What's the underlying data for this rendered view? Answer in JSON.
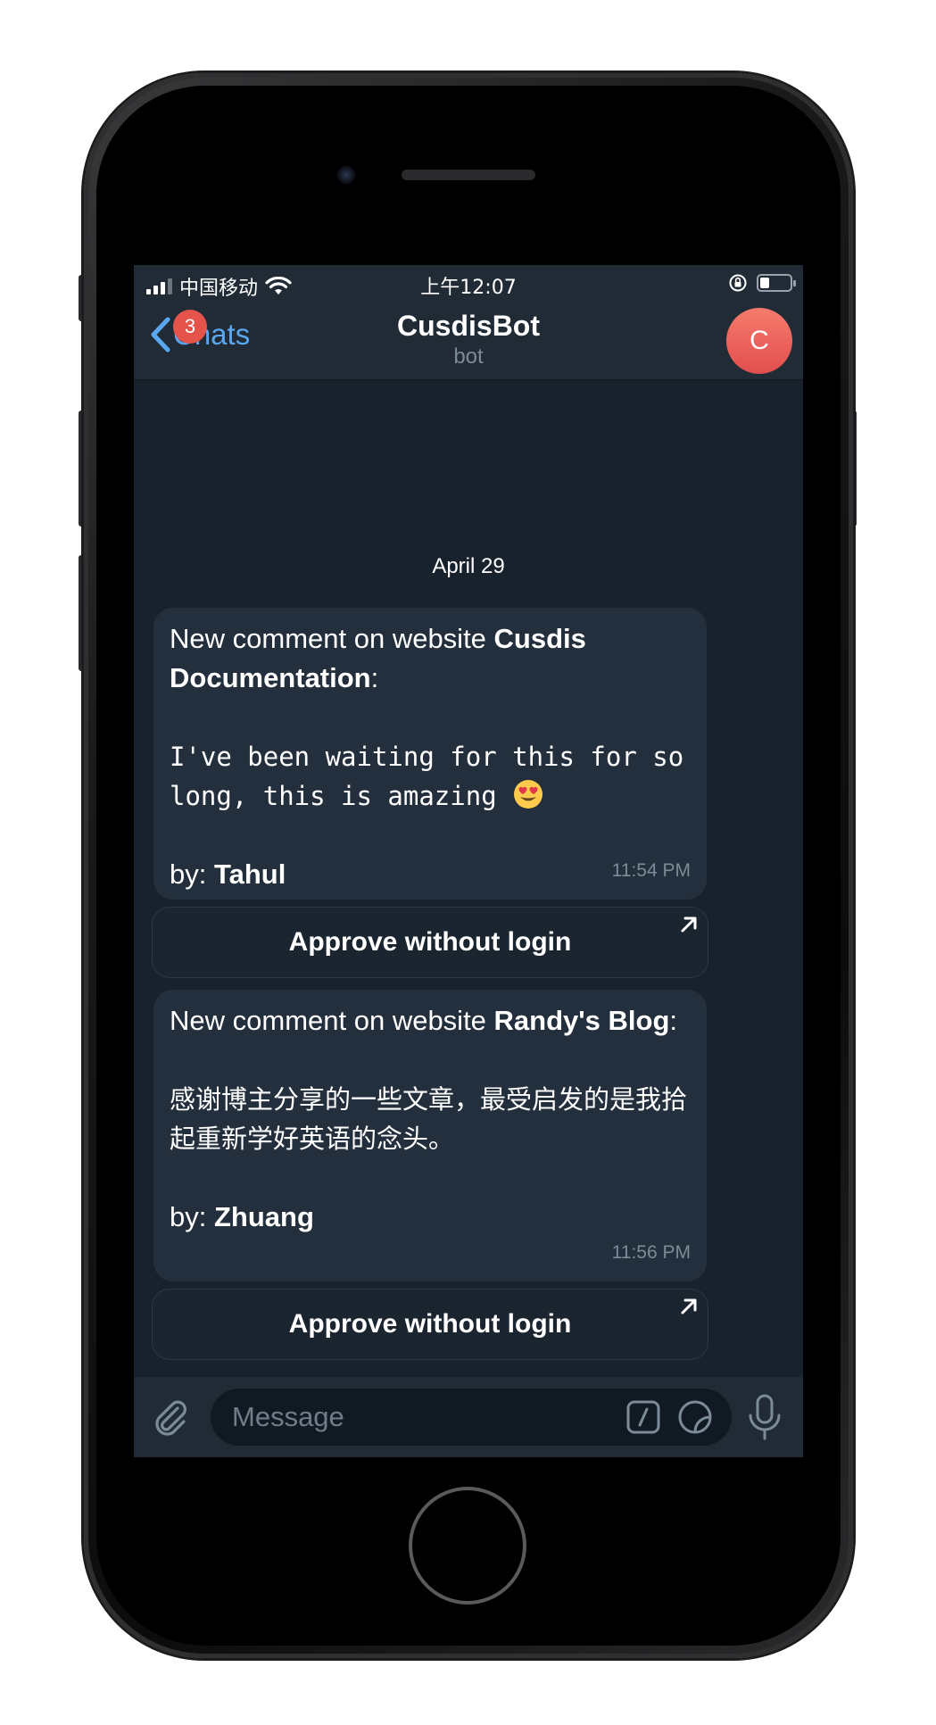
{
  "status_bar": {
    "carrier": "中国移动",
    "time": "上午12:07"
  },
  "nav": {
    "back_label": "Chats",
    "unread_count": "3",
    "title": "CusdisBot",
    "subtitle": "bot",
    "avatar_letter": "C"
  },
  "chat": {
    "date": "April 29",
    "messages": [
      {
        "intro": "New comment on website ",
        "site": "Cusdis Documentation",
        "colon": ":",
        "body": "I've been waiting for this for so long, this is amazing ",
        "by_label": "by: ",
        "author": "Tahul",
        "time": "11:54 PM",
        "button_label": "Approve without login"
      },
      {
        "intro": "New comment on website ",
        "site": "Randy's Blog",
        "colon": ":",
        "body": "感谢博主分享的一些文章，最受启发的是我拾起重新学好英语的念头。",
        "by_label": "by: ",
        "author": "Zhuang",
        "time": "11:56 PM",
        "button_label": "Approve without login"
      }
    ]
  },
  "input_bar": {
    "placeholder": "Message"
  },
  "colors": {
    "accent": "#5aa7f0",
    "badge": "#e5534b",
    "chat_background": "#18222d",
    "bubble": "#232f3c",
    "header": "#202b36"
  }
}
